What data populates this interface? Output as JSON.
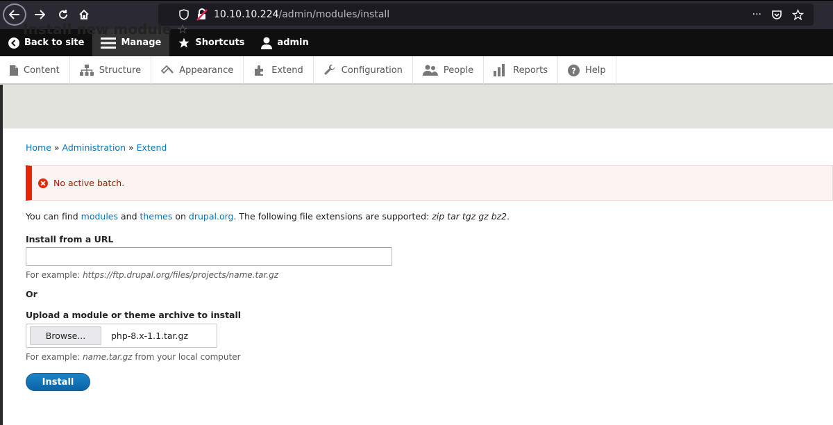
{
  "browser": {
    "url_host": "10.10.10.224",
    "url_path": "/admin/modules/install",
    "more_glyph": "···"
  },
  "toolbar": {
    "items": [
      {
        "label": "Back to site",
        "icon": "back-circle-icon"
      },
      {
        "label": "Manage",
        "icon": "hamburger-icon"
      },
      {
        "label": "Shortcuts",
        "icon": "star-icon"
      },
      {
        "label": "admin",
        "icon": "user-icon"
      }
    ]
  },
  "tray": {
    "items": [
      {
        "label": "Content",
        "icon": "document-icon"
      },
      {
        "label": "Structure",
        "icon": "sitemap-icon"
      },
      {
        "label": "Appearance",
        "icon": "brush-icon"
      },
      {
        "label": "Extend",
        "icon": "puzzle-icon"
      },
      {
        "label": "Configuration",
        "icon": "wrench-icon"
      },
      {
        "label": "People",
        "icon": "people-icon"
      },
      {
        "label": "Reports",
        "icon": "bar-chart-icon"
      },
      {
        "label": "Help",
        "icon": "help-icon"
      }
    ]
  },
  "page": {
    "title": "Install new module",
    "star": "☆"
  },
  "breadcrumb": {
    "home": "Home",
    "sep": " » ",
    "administration": "Administration",
    "extend": "Extend"
  },
  "message": {
    "text": "No active batch."
  },
  "help": {
    "prefix": "You can find ",
    "modules": "modules",
    "and": " and ",
    "themes": "themes",
    "on": " on ",
    "drupal": "drupal.org",
    "suffix": ". The following file extensions are supported: ",
    "extensions": "zip tar tgz gz bz2",
    "end": "."
  },
  "form": {
    "url_label": "Install from a URL",
    "url_value": "",
    "url_desc_prefix": "For example: ",
    "url_desc_example": "https://ftp.drupal.org/files/projects/name.tar.gz",
    "or_label": "Or",
    "upload_label": "Upload a module or theme archive to install",
    "browse_label": "Browse...",
    "file_name": "php-8.x-1.1.tar.gz",
    "upload_desc_prefix": "For example: ",
    "upload_desc_example": "name.tar.gz",
    "upload_desc_suffix": " from your local computer",
    "install_label": "Install"
  },
  "colors": {
    "link": "#0074bd",
    "error_border": "#e62600",
    "error_text": "#a51b00",
    "primary_button": "#0a63a8"
  }
}
